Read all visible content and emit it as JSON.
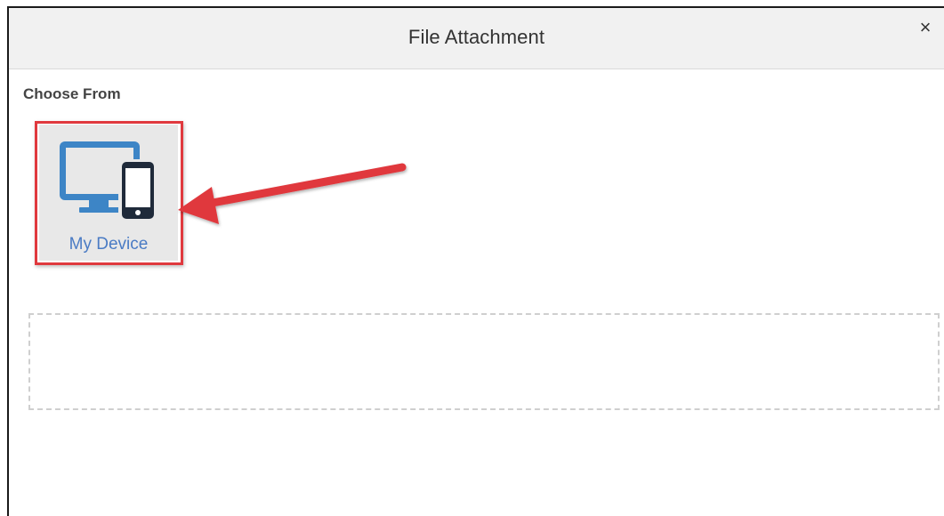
{
  "dialog": {
    "title": "File Attachment",
    "close_label": "×"
  },
  "choose": {
    "section_label": "Choose From",
    "sources": [
      {
        "label": "My Device",
        "icon": "computer-and-phone-icon",
        "highlighted": true
      }
    ]
  },
  "colors": {
    "header_bg": "#f1f1f1",
    "tile_bg": "#e8e8e8",
    "highlight": "#e0393e",
    "monitor_blue": "#3d85c6",
    "phone_dark": "#1f2a3a",
    "link_blue": "#4a7bc4"
  },
  "annotation": {
    "arrow_color": "#e0393e",
    "points_to": "My Device"
  }
}
